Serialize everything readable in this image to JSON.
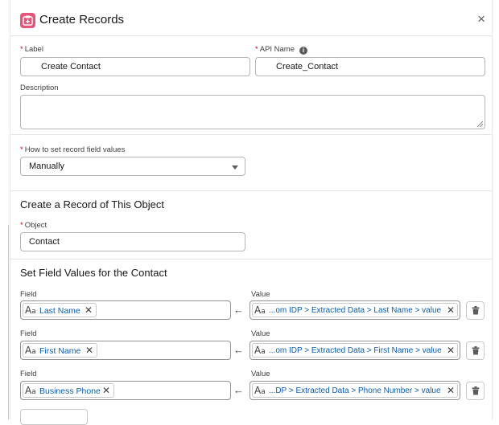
{
  "modal": {
    "title": "Create Records",
    "close_glyph": "×"
  },
  "label": {
    "text": "Label",
    "required": "*",
    "value": "Create Contact"
  },
  "api_name": {
    "text": "API Name",
    "required": "*",
    "value": "Create_Contact",
    "info_glyph": "i"
  },
  "description": {
    "text": "Description",
    "value": ""
  },
  "how_to_set": {
    "text": "How to set record field values",
    "required": "*",
    "value": "Manually"
  },
  "object_section": {
    "title": "Create a Record of This Object",
    "object_label": "Object",
    "required": "*",
    "object_value": "Contact"
  },
  "field_values": {
    "title": "Set Field Values for the Contact",
    "field_label": "Field",
    "value_label": "Value",
    "arrow": "←",
    "aa_big": "A",
    "aa_small": "a",
    "remove_glyph": "✕",
    "rows": [
      {
        "field": "Last Name",
        "value": "...om IDP > Extracted Data > Last Name > value"
      },
      {
        "field": "First Name",
        "value": "...om IDP > Extracted Data > First Name > value"
      },
      {
        "field": "Business Phone",
        "value": "...DP > Extracted Data > Phone Number > value"
      }
    ]
  },
  "colors": {
    "icon_bg": "#e3567a",
    "link": "#0b5cab",
    "required": "#ba0517"
  }
}
